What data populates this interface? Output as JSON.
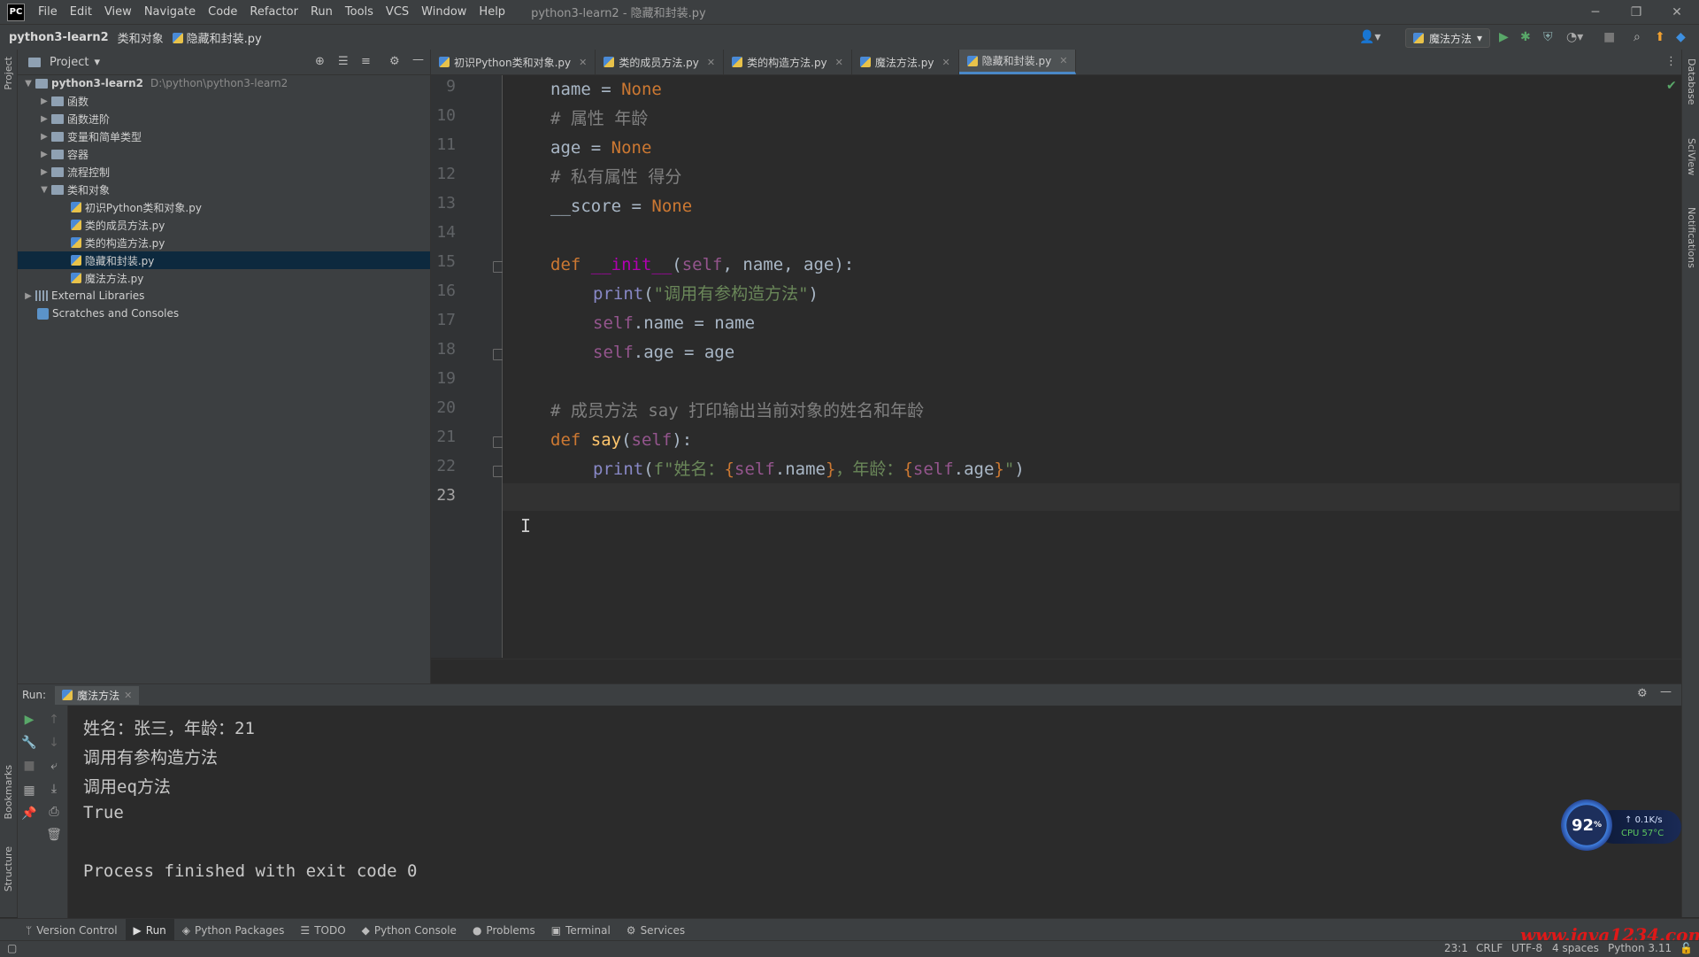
{
  "window": {
    "logo": "PC",
    "title": "python3-learn2 - 隐藏和封装.py",
    "menu": [
      "File",
      "Edit",
      "View",
      "Navigate",
      "Code",
      "Refactor",
      "Run",
      "Tools",
      "VCS",
      "Window",
      "Help"
    ],
    "controls": [
      "minimize-icon",
      "restore-icon",
      "close-icon"
    ]
  },
  "navbar": {
    "crumbs": [
      "python3-learn2",
      "类和对象",
      "隐藏和封装.py"
    ],
    "run_config": "魔法方法"
  },
  "left_strip": {
    "labels": [
      "Project",
      "Bookmarks",
      "Structure"
    ]
  },
  "right_strip": {
    "labels": [
      "Database",
      "SciView",
      "Notifications"
    ]
  },
  "project": {
    "title": "Project",
    "tree": [
      {
        "label": "python3-learn2",
        "hint": "D:\\python\\python3-learn2",
        "type": "root",
        "expanded": true,
        "depth": 0
      },
      {
        "label": "函数",
        "type": "folder",
        "depth": 1
      },
      {
        "label": "函数进阶",
        "type": "folder",
        "depth": 1
      },
      {
        "label": "变量和简单类型",
        "type": "folder",
        "depth": 1
      },
      {
        "label": "容器",
        "type": "folder",
        "depth": 1
      },
      {
        "label": "流程控制",
        "type": "folder",
        "depth": 1
      },
      {
        "label": "类和对象",
        "type": "folder",
        "expanded": true,
        "depth": 1
      },
      {
        "label": "初识Python类和对象.py",
        "type": "file",
        "depth": 2
      },
      {
        "label": "类的成员方法.py",
        "type": "file",
        "depth": 2
      },
      {
        "label": "类的构造方法.py",
        "type": "file",
        "depth": 2
      },
      {
        "label": "隐藏和封装.py",
        "type": "file",
        "depth": 2,
        "selected": true
      },
      {
        "label": "魔法方法.py",
        "type": "file",
        "depth": 2
      },
      {
        "label": "External Libraries",
        "type": "lib",
        "depth": 0
      },
      {
        "label": "Scratches and Consoles",
        "type": "scratch",
        "depth": 0
      }
    ]
  },
  "tabs": [
    {
      "label": "初识Python类和对象.py",
      "active": false
    },
    {
      "label": "类的成员方法.py",
      "active": false
    },
    {
      "label": "类的构造方法.py",
      "active": false
    },
    {
      "label": "魔法方法.py",
      "active": false
    },
    {
      "label": "隐藏和封装.py",
      "active": true
    }
  ],
  "editor": {
    "line_numbers": [
      "9",
      "10",
      "11",
      "12",
      "13",
      "14",
      "15",
      "16",
      "17",
      "18",
      "19",
      "20",
      "21",
      "22",
      "23"
    ],
    "current_line": "23",
    "lines": {
      "l9": [
        "name = ",
        "None"
      ],
      "l10": [
        "# 属性 年龄"
      ],
      "l11": [
        "age = ",
        "None"
      ],
      "l12": [
        "# 私有属性 得分"
      ],
      "l13": [
        "__score = ",
        "None"
      ],
      "l15": [
        "def ",
        "__init__",
        "(",
        "self",
        ", name, age):"
      ],
      "l16": [
        "print",
        "(",
        "\"调用有参构造方法\"",
        ")"
      ],
      "l17": [
        "self",
        ".name = name"
      ],
      "l18": [
        "self",
        ".age = age"
      ],
      "l20": [
        "# 成员方法 say 打印输出当前对象的姓名和年龄"
      ],
      "l21": [
        "def ",
        "say",
        "(",
        "self",
        "):"
      ],
      "l22": [
        "print",
        "(",
        "f\"姓名：",
        "{",
        "self",
        ".name",
        "}",
        "，年龄：",
        "{",
        "self",
        ".age",
        "}",
        "\"",
        ")"
      ]
    }
  },
  "run": {
    "label": "Run:",
    "tab": "魔法方法",
    "output": [
      "姓名：张三，年龄：21",
      "调用有参构造方法",
      "调用eq方法",
      "True",
      "",
      "Process finished with exit code 0"
    ]
  },
  "bottom_tools": [
    {
      "label": "Version Control",
      "icon": "branch-icon"
    },
    {
      "label": "Run",
      "icon": "play-icon",
      "active": true
    },
    {
      "label": "Python Packages",
      "icon": "package-icon"
    },
    {
      "label": "TODO",
      "icon": "list-icon"
    },
    {
      "label": "Python Console",
      "icon": "python-icon"
    },
    {
      "label": "Problems",
      "icon": "warning-icon"
    },
    {
      "label": "Terminal",
      "icon": "terminal-icon"
    },
    {
      "label": "Services",
      "icon": "services-icon"
    }
  ],
  "status": {
    "position": "23:1",
    "line_sep": "CRLF",
    "encoding": "UTF-8",
    "indent": "4 spaces",
    "interpreter": "Python 3.11"
  },
  "widget": {
    "percent": "92",
    "unit": "%",
    "net": "0.1K/s",
    "cpu": "CPU 57°C"
  },
  "watermark": "www.java1234.com",
  "colors": {
    "keyword": "#cc7832",
    "comment": "#808080",
    "function": "#ffc66d",
    "string": "#6a8759",
    "self": "#94558d",
    "accent": "#4a88c7"
  }
}
